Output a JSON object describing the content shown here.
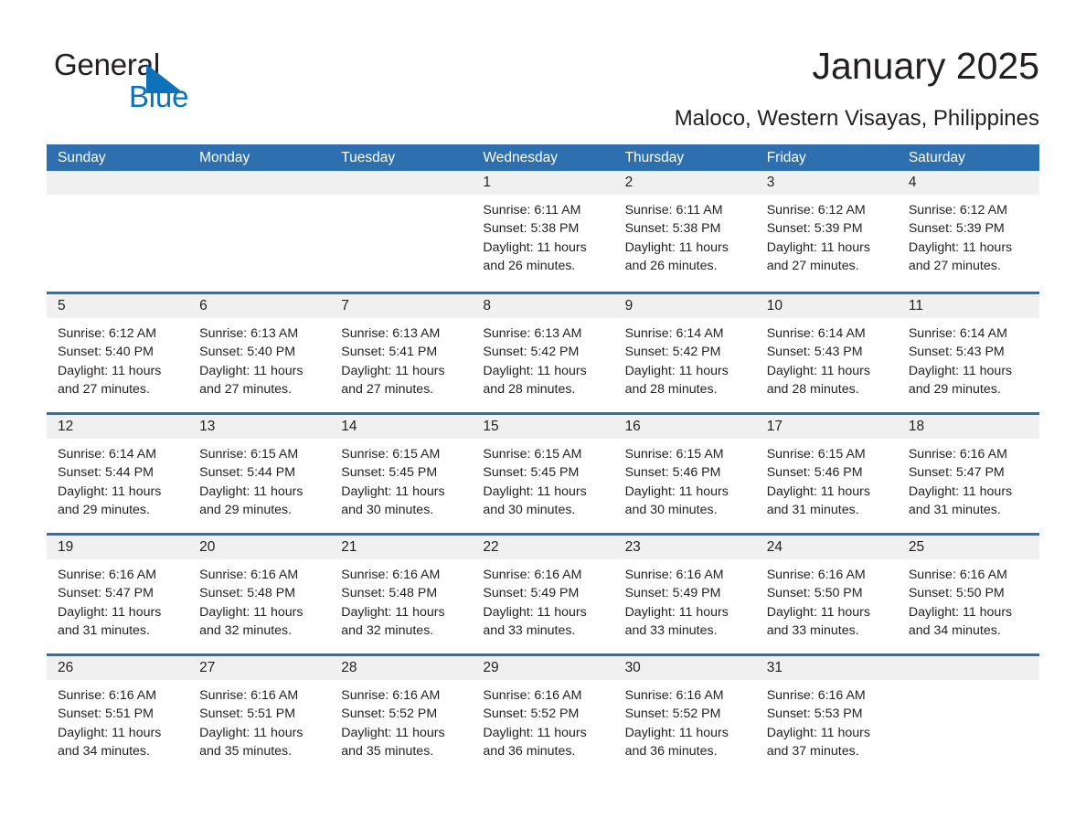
{
  "brand": {
    "name_part1": "General",
    "name_part2": "Blue",
    "logo_icon": "triangle-flag-icon",
    "accent_color": "#0d72b9"
  },
  "header": {
    "title": "January 2025",
    "location": "Maloco, Western Visayas, Philippines"
  },
  "theme": {
    "header_blue": "#2e6fb0",
    "daynum_band": "#f0f0f0",
    "text": "#231f20"
  },
  "calendar": {
    "weekday_headers": [
      "Sunday",
      "Monday",
      "Tuesday",
      "Wednesday",
      "Thursday",
      "Friday",
      "Saturday"
    ],
    "weeks": [
      [
        {
          "day": "",
          "sunrise": "",
          "sunset": "",
          "daylight1": "",
          "daylight2": ""
        },
        {
          "day": "",
          "sunrise": "",
          "sunset": "",
          "daylight1": "",
          "daylight2": ""
        },
        {
          "day": "",
          "sunrise": "",
          "sunset": "",
          "daylight1": "",
          "daylight2": ""
        },
        {
          "day": "1",
          "sunrise": "Sunrise: 6:11 AM",
          "sunset": "Sunset: 5:38 PM",
          "daylight1": "Daylight: 11 hours",
          "daylight2": "and 26 minutes."
        },
        {
          "day": "2",
          "sunrise": "Sunrise: 6:11 AM",
          "sunset": "Sunset: 5:38 PM",
          "daylight1": "Daylight: 11 hours",
          "daylight2": "and 26 minutes."
        },
        {
          "day": "3",
          "sunrise": "Sunrise: 6:12 AM",
          "sunset": "Sunset: 5:39 PM",
          "daylight1": "Daylight: 11 hours",
          "daylight2": "and 27 minutes."
        },
        {
          "day": "4",
          "sunrise": "Sunrise: 6:12 AM",
          "sunset": "Sunset: 5:39 PM",
          "daylight1": "Daylight: 11 hours",
          "daylight2": "and 27 minutes."
        }
      ],
      [
        {
          "day": "5",
          "sunrise": "Sunrise: 6:12 AM",
          "sunset": "Sunset: 5:40 PM",
          "daylight1": "Daylight: 11 hours",
          "daylight2": "and 27 minutes."
        },
        {
          "day": "6",
          "sunrise": "Sunrise: 6:13 AM",
          "sunset": "Sunset: 5:40 PM",
          "daylight1": "Daylight: 11 hours",
          "daylight2": "and 27 minutes."
        },
        {
          "day": "7",
          "sunrise": "Sunrise: 6:13 AM",
          "sunset": "Sunset: 5:41 PM",
          "daylight1": "Daylight: 11 hours",
          "daylight2": "and 27 minutes."
        },
        {
          "day": "8",
          "sunrise": "Sunrise: 6:13 AM",
          "sunset": "Sunset: 5:42 PM",
          "daylight1": "Daylight: 11 hours",
          "daylight2": "and 28 minutes."
        },
        {
          "day": "9",
          "sunrise": "Sunrise: 6:14 AM",
          "sunset": "Sunset: 5:42 PM",
          "daylight1": "Daylight: 11 hours",
          "daylight2": "and 28 minutes."
        },
        {
          "day": "10",
          "sunrise": "Sunrise: 6:14 AM",
          "sunset": "Sunset: 5:43 PM",
          "daylight1": "Daylight: 11 hours",
          "daylight2": "and 28 minutes."
        },
        {
          "day": "11",
          "sunrise": "Sunrise: 6:14 AM",
          "sunset": "Sunset: 5:43 PM",
          "daylight1": "Daylight: 11 hours",
          "daylight2": "and 29 minutes."
        }
      ],
      [
        {
          "day": "12",
          "sunrise": "Sunrise: 6:14 AM",
          "sunset": "Sunset: 5:44 PM",
          "daylight1": "Daylight: 11 hours",
          "daylight2": "and 29 minutes."
        },
        {
          "day": "13",
          "sunrise": "Sunrise: 6:15 AM",
          "sunset": "Sunset: 5:44 PM",
          "daylight1": "Daylight: 11 hours",
          "daylight2": "and 29 minutes."
        },
        {
          "day": "14",
          "sunrise": "Sunrise: 6:15 AM",
          "sunset": "Sunset: 5:45 PM",
          "daylight1": "Daylight: 11 hours",
          "daylight2": "and 30 minutes."
        },
        {
          "day": "15",
          "sunrise": "Sunrise: 6:15 AM",
          "sunset": "Sunset: 5:45 PM",
          "daylight1": "Daylight: 11 hours",
          "daylight2": "and 30 minutes."
        },
        {
          "day": "16",
          "sunrise": "Sunrise: 6:15 AM",
          "sunset": "Sunset: 5:46 PM",
          "daylight1": "Daylight: 11 hours",
          "daylight2": "and 30 minutes."
        },
        {
          "day": "17",
          "sunrise": "Sunrise: 6:15 AM",
          "sunset": "Sunset: 5:46 PM",
          "daylight1": "Daylight: 11 hours",
          "daylight2": "and 31 minutes."
        },
        {
          "day": "18",
          "sunrise": "Sunrise: 6:16 AM",
          "sunset": "Sunset: 5:47 PM",
          "daylight1": "Daylight: 11 hours",
          "daylight2": "and 31 minutes."
        }
      ],
      [
        {
          "day": "19",
          "sunrise": "Sunrise: 6:16 AM",
          "sunset": "Sunset: 5:47 PM",
          "daylight1": "Daylight: 11 hours",
          "daylight2": "and 31 minutes."
        },
        {
          "day": "20",
          "sunrise": "Sunrise: 6:16 AM",
          "sunset": "Sunset: 5:48 PM",
          "daylight1": "Daylight: 11 hours",
          "daylight2": "and 32 minutes."
        },
        {
          "day": "21",
          "sunrise": "Sunrise: 6:16 AM",
          "sunset": "Sunset: 5:48 PM",
          "daylight1": "Daylight: 11 hours",
          "daylight2": "and 32 minutes."
        },
        {
          "day": "22",
          "sunrise": "Sunrise: 6:16 AM",
          "sunset": "Sunset: 5:49 PM",
          "daylight1": "Daylight: 11 hours",
          "daylight2": "and 33 minutes."
        },
        {
          "day": "23",
          "sunrise": "Sunrise: 6:16 AM",
          "sunset": "Sunset: 5:49 PM",
          "daylight1": "Daylight: 11 hours",
          "daylight2": "and 33 minutes."
        },
        {
          "day": "24",
          "sunrise": "Sunrise: 6:16 AM",
          "sunset": "Sunset: 5:50 PM",
          "daylight1": "Daylight: 11 hours",
          "daylight2": "and 33 minutes."
        },
        {
          "day": "25",
          "sunrise": "Sunrise: 6:16 AM",
          "sunset": "Sunset: 5:50 PM",
          "daylight1": "Daylight: 11 hours",
          "daylight2": "and 34 minutes."
        }
      ],
      [
        {
          "day": "26",
          "sunrise": "Sunrise: 6:16 AM",
          "sunset": "Sunset: 5:51 PM",
          "daylight1": "Daylight: 11 hours",
          "daylight2": "and 34 minutes."
        },
        {
          "day": "27",
          "sunrise": "Sunrise: 6:16 AM",
          "sunset": "Sunset: 5:51 PM",
          "daylight1": "Daylight: 11 hours",
          "daylight2": "and 35 minutes."
        },
        {
          "day": "28",
          "sunrise": "Sunrise: 6:16 AM",
          "sunset": "Sunset: 5:52 PM",
          "daylight1": "Daylight: 11 hours",
          "daylight2": "and 35 minutes."
        },
        {
          "day": "29",
          "sunrise": "Sunrise: 6:16 AM",
          "sunset": "Sunset: 5:52 PM",
          "daylight1": "Daylight: 11 hours",
          "daylight2": "and 36 minutes."
        },
        {
          "day": "30",
          "sunrise": "Sunrise: 6:16 AM",
          "sunset": "Sunset: 5:52 PM",
          "daylight1": "Daylight: 11 hours",
          "daylight2": "and 36 minutes."
        },
        {
          "day": "31",
          "sunrise": "Sunrise: 6:16 AM",
          "sunset": "Sunset: 5:53 PM",
          "daylight1": "Daylight: 11 hours",
          "daylight2": "and 37 minutes."
        },
        {
          "day": "",
          "sunrise": "",
          "sunset": "",
          "daylight1": "",
          "daylight2": ""
        }
      ]
    ]
  }
}
